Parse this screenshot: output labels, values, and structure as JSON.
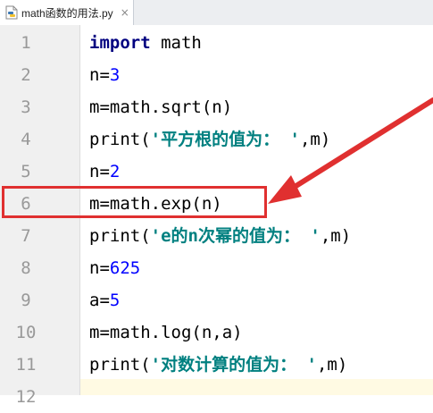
{
  "tab": {
    "filename": "math函数的用法.py",
    "close": "×"
  },
  "lines": [
    {
      "num": "1",
      "code": "import math"
    },
    {
      "num": "2",
      "code": "n=3"
    },
    {
      "num": "3",
      "code": "m=math.sqrt(n)"
    },
    {
      "num": "4",
      "code": "print('平方根的值为： ',m)"
    },
    {
      "num": "5",
      "code": "n=2"
    },
    {
      "num": "6",
      "code": "m=math.exp(n)"
    },
    {
      "num": "7",
      "code": "print('e的n次幂的值为： ',m)"
    },
    {
      "num": "8",
      "code": "n=625"
    },
    {
      "num": "9",
      "code": "a=5"
    },
    {
      "num": "10",
      "code": "m=math.log(n,a)"
    },
    {
      "num": "11",
      "code": "print('对数计算的值为： ',m)"
    },
    {
      "num": "12",
      "code": ""
    }
  ],
  "colors": {
    "highlight": "#e03030",
    "keyword": "#000080",
    "number": "#0000ff",
    "string": "#008080"
  }
}
